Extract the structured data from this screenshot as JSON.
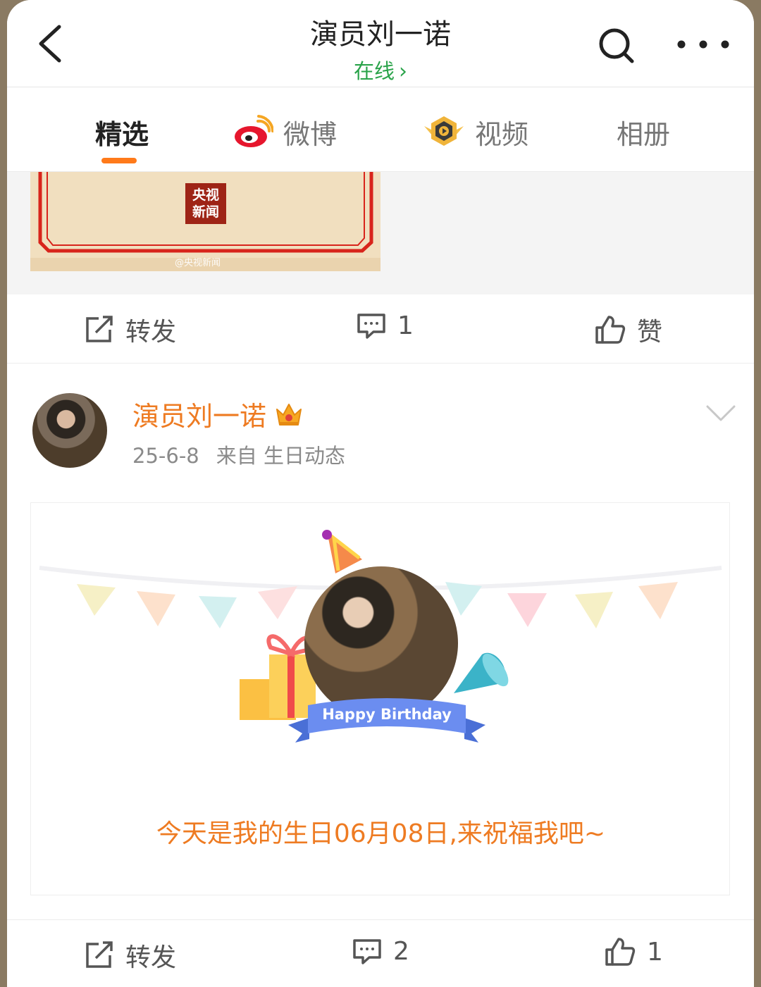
{
  "header": {
    "title": "演员刘一诺",
    "status": "在线",
    "status_chevron": "›"
  },
  "tabs": [
    {
      "label": "精选",
      "active": true
    },
    {
      "label": "微博",
      "active": false
    },
    {
      "label": "视频",
      "active": false
    },
    {
      "label": "相册",
      "active": false
    }
  ],
  "prev_post": {
    "image_badge": [
      "央视",
      "新闻"
    ],
    "image_watermark": "@央视新闻",
    "actions": {
      "repost_label": "转发",
      "comment_count": "1",
      "like_label": "赞"
    }
  },
  "post": {
    "author": "演员刘一诺",
    "date": "25-6-8",
    "source": "来自 生日动态",
    "card": {
      "ribbon_text": "Happy Birthday",
      "message": "今天是我的生日06月08日,来祝福我吧~"
    },
    "actions": {
      "repost_label": "转发",
      "comment_count": "2",
      "like_count": "1"
    }
  },
  "colors": {
    "accent_orange": "#ee7b22",
    "online_green": "#2aa34a",
    "tab_underline": "#ff7a1a"
  }
}
